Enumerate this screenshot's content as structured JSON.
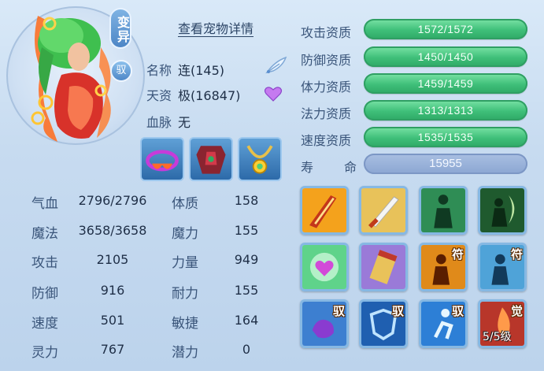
{
  "header": {
    "badge_variant": "变异",
    "badge_tame": "驭",
    "detail_link": "查看宠物详情"
  },
  "info": {
    "name_label": "名称",
    "name_value": "连(145)",
    "talent_label": "天资",
    "talent_value": "极(16847)",
    "bloodline_label": "血脉",
    "bloodline_value": "无"
  },
  "attributes": [
    {
      "label": "气血",
      "value": "2796/2796",
      "label2": "体质",
      "value2": "158"
    },
    {
      "label": "魔法",
      "value": "3658/3658",
      "label2": "魔力",
      "value2": "155"
    },
    {
      "label": "攻击",
      "value": "2105",
      "label2": "力量",
      "value2": "949"
    },
    {
      "label": "防御",
      "value": "916",
      "label2": "耐力",
      "value2": "155"
    },
    {
      "label": "速度",
      "value": "501",
      "label2": "敏捷",
      "value2": "164"
    },
    {
      "label": "灵力",
      "value": "767",
      "label2": "潜力",
      "value2": "0"
    }
  ],
  "aptitudes": [
    {
      "label": "攻击资质",
      "value": "1572/1572",
      "fill": 1.0
    },
    {
      "label": "防御资质",
      "value": "1450/1450",
      "fill": 1.0
    },
    {
      "label": "体力资质",
      "value": "1459/1459",
      "fill": 1.0
    },
    {
      "label": "法力资质",
      "value": "1313/1313",
      "fill": 1.0
    },
    {
      "label": "速度资质",
      "value": "1535/1535",
      "fill": 1.0
    }
  ],
  "life": {
    "label_a": "寿",
    "label_b": "命",
    "value": "15955"
  },
  "skills": {
    "tag_fu": "符",
    "tag_yu": "驭",
    "tag_jue": "觉",
    "awaken_level": "5/5级"
  },
  "colors": {
    "bar_green": "#3fbf79",
    "bar_blue": "#8ba6d2",
    "bg": "#c7dbf0"
  }
}
